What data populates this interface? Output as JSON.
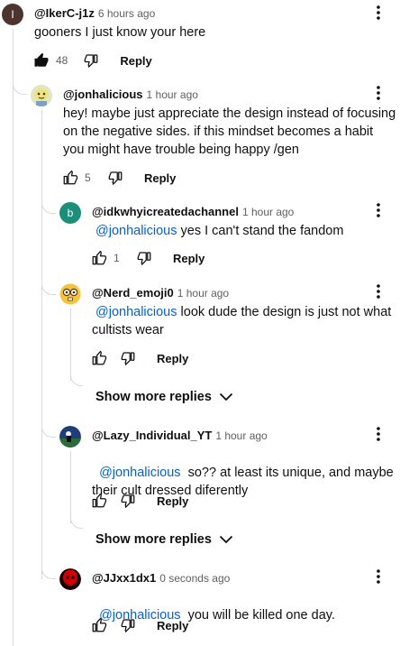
{
  "comments": [
    {
      "author": "@IkerC-j1z",
      "time": "6 hours ago",
      "avatar_letter": "I",
      "avatar_color": "#4e342e",
      "text": "gooners I just know your here",
      "likes": "48",
      "liked": true,
      "reply_label": "Reply"
    },
    {
      "author": "@jonhalicious",
      "time": "1 hour ago",
      "text": "hey! maybe just appreciate the design instead of focusing on the negative sides. if this mindset becomes a habit you might have trouble being happy /gen",
      "likes": "5",
      "reply_label": "Reply"
    },
    {
      "author": "@idkwhyicreatedachannel",
      "time": "1 hour ago",
      "avatar_letter": "b",
      "avatar_color": "#1b8f7a",
      "mention": "@jonhalicious",
      "text": " yes I can't stand the fandom",
      "likes": "1",
      "reply_label": "Reply"
    },
    {
      "author": "@Nerd_emoji0",
      "time": "1 hour ago",
      "mention": "@jonhalicious",
      "text": " look dude the design is just not what cultists wear",
      "reply_label": "Reply"
    },
    {
      "author": "@Lazy_Individual_YT",
      "time": "1 hour ago",
      "mention": "@jonhalicious",
      "text": "  so?? at least its unique, and maybe their cult dressed diferently",
      "reply_label": "Reply"
    },
    {
      "author": "@JJxx1dx1",
      "time": "0 seconds ago",
      "mention": "@jonhalicious",
      "text": "  you will be killed one day.",
      "reply_label": "Reply"
    }
  ],
  "show_more": [
    {
      "label": "Show more replies"
    },
    {
      "label": "Show more replies"
    }
  ],
  "icons": {
    "like": "thumbs-up-icon",
    "dislike": "thumbs-down-icon",
    "more": "more-vert-icon",
    "expand": "chevron-down-icon"
  }
}
